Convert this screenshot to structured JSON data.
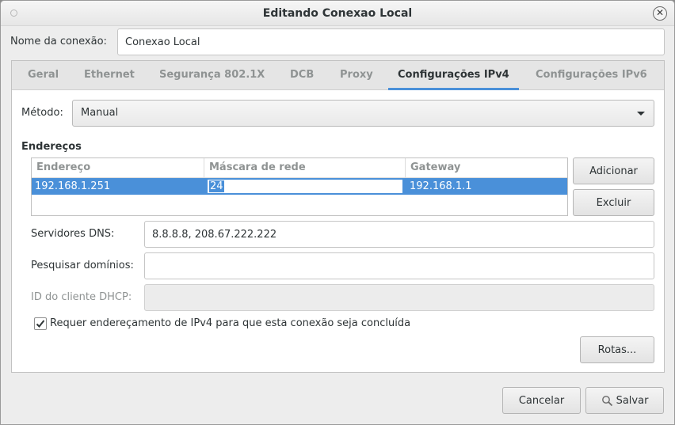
{
  "window": {
    "title": "Editando Conexao Local"
  },
  "connection": {
    "name_label": "Nome da conexão:",
    "name_value": "Conexao Local"
  },
  "tabs": [
    {
      "label": "Geral",
      "active": false
    },
    {
      "label": "Ethernet",
      "active": false
    },
    {
      "label": "Segurança 802.1X",
      "active": false
    },
    {
      "label": "DCB",
      "active": false
    },
    {
      "label": "Proxy",
      "active": false
    },
    {
      "label": "Configurações IPv4",
      "active": true
    },
    {
      "label": "Configurações IPv6",
      "active": false
    }
  ],
  "ipv4": {
    "method_label": "Método:",
    "method_value": "Manual",
    "addresses_title": "Endereços",
    "columns": [
      "Endereço",
      "Máscara de rede",
      "Gateway"
    ],
    "rows": [
      {
        "address": "192.168.1.251",
        "netmask": "24",
        "gateway": "192.168.1.1"
      }
    ],
    "add_button": "Adicionar",
    "delete_button": "Excluir",
    "dns_label": "Servidores DNS:",
    "dns_value": "8.8.8.8, 208.67.222.222",
    "search_domains_label": "Pesquisar domínios:",
    "search_domains_value": "",
    "dhcp_client_id_label": "ID do cliente DHCP:",
    "dhcp_client_id_value": "",
    "require_ipv4_label": "Requer endereçamento de IPv4 para que esta conexão seja concluída",
    "require_ipv4_checked": true,
    "routes_button": "Rotas..."
  },
  "footer": {
    "cancel_button": "Cancelar",
    "save_button": "Salvar"
  },
  "colors": {
    "accent": "#4a90d9",
    "window_bg": "#ededed"
  }
}
